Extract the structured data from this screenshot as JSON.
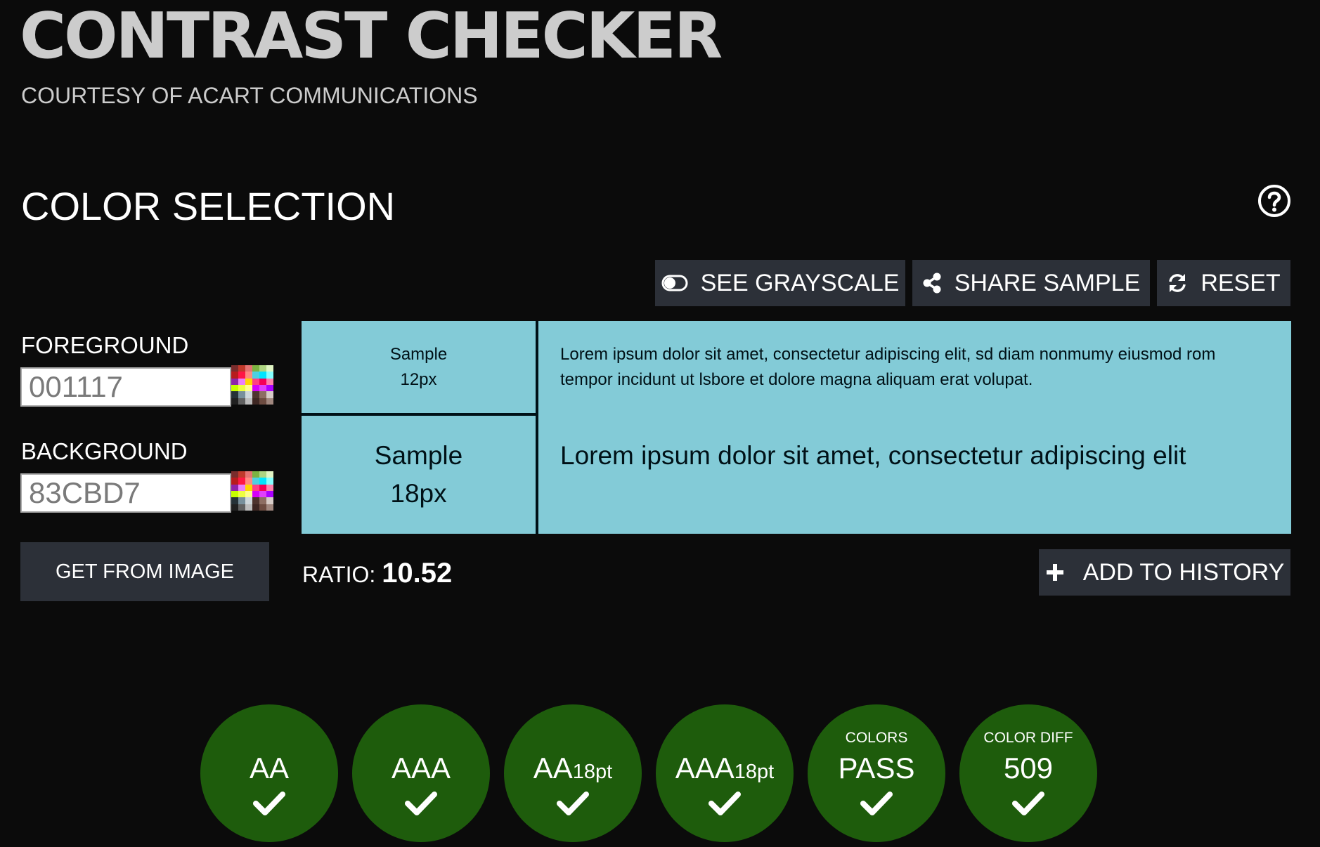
{
  "header": {
    "title": "CONTRAST CHECKER",
    "subtitle": "COURTESY OF ACART COMMUNICATIONS"
  },
  "color_selection": {
    "heading": "COLOR SELECTION",
    "help_icon": "question-circle-icon"
  },
  "toolbar": {
    "grayscale_label": "SEE GRAYSCALE",
    "grayscale_icon": "toggle-icon",
    "share_label": "SHARE SAMPLE",
    "share_icon": "share-icon",
    "reset_label": "RESET",
    "reset_icon": "refresh-icon"
  },
  "foreground": {
    "label": "FOREGROUND",
    "value": "001117",
    "color": "#001117"
  },
  "background": {
    "label": "BACKGROUND",
    "value": "83CBD7",
    "color": "#83CBD7"
  },
  "get_from_image_label": "GET FROM IMAGE",
  "samples": {
    "small": {
      "label_line1": "Sample",
      "label_line2": "12px",
      "text": "Lorem ipsum dolor sit amet, consectetur adipiscing elit, sd diam nonmumy eiusmod rom tempor incidunt ut lsbore et dolore magna aliquam erat volupat."
    },
    "large": {
      "label_line1": "Sample",
      "label_line2": "18px",
      "text": "Lorem ipsum dolor sit amet, consectetur adipiscing elit"
    }
  },
  "ratio": {
    "label": "RATIO:",
    "value": "10.52"
  },
  "add_to_history_label": "ADD TO HISTORY",
  "add_to_history_icon": "plus-icon",
  "results": {
    "pass_color": "#1E5C0C",
    "badges": [
      {
        "top": "",
        "main": "AA",
        "sub": "",
        "status_icon": "check-icon"
      },
      {
        "top": "",
        "main": "AAA",
        "sub": "",
        "status_icon": "check-icon"
      },
      {
        "top": "",
        "main": "AA",
        "sub": "18pt",
        "status_icon": "check-icon"
      },
      {
        "top": "",
        "main": "AAA",
        "sub": "18pt",
        "status_icon": "check-icon"
      },
      {
        "top": "COLORS",
        "main": "PASS",
        "sub": "",
        "status_icon": "check-icon"
      },
      {
        "top": "COLOR DIFF",
        "main": "509",
        "sub": "",
        "status_icon": "check-icon"
      }
    ]
  }
}
